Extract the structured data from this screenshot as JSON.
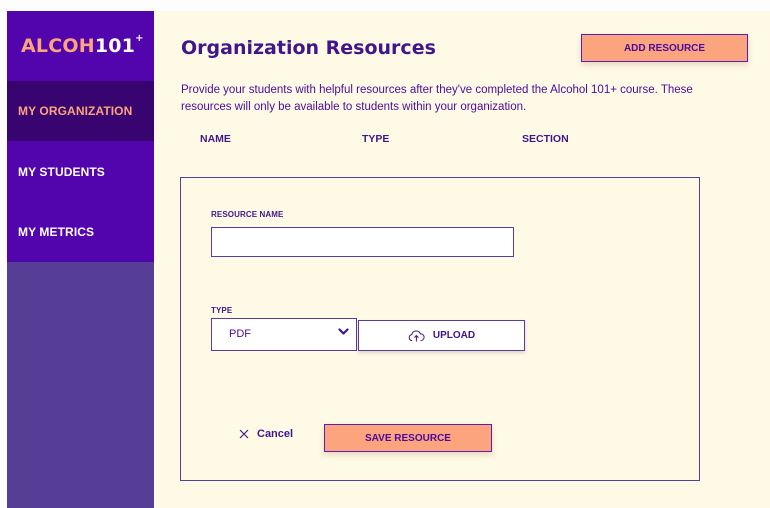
{
  "sidebar": {
    "logo": {
      "main": "ALCOH",
      "num": "101",
      "sup": "+"
    },
    "items": [
      {
        "label": "MY ORGANIZATION",
        "active": true
      },
      {
        "label": "MY STUDENTS",
        "active": false
      },
      {
        "label": "MY METRICS",
        "active": false
      }
    ]
  },
  "main": {
    "title": "Organization Resources",
    "add_button": "ADD RESOURCE",
    "description": "Provide your students with helpful resources after they've completed the Alcohol 101+ course. These resources will only be available to students within your organization.",
    "columns": [
      "NAME",
      "TYPE",
      "SECTION"
    ]
  },
  "form": {
    "resource_name_label": "RESOURCE NAME",
    "resource_name_value": "",
    "type_label": "TYPE",
    "type_value": "PDF",
    "upload_label": "UPLOAD",
    "cancel_label": "Cancel",
    "save_label": "SAVE RESOURCE"
  },
  "icons": {
    "chevron": "chevron-down-icon",
    "upload": "cloud-upload-icon",
    "close": "close-icon"
  },
  "colors": {
    "accent": "#fba47e",
    "primary": "#5204ad",
    "nav_active": "#38046f",
    "text": "#40168a",
    "background": "#fffae6"
  }
}
